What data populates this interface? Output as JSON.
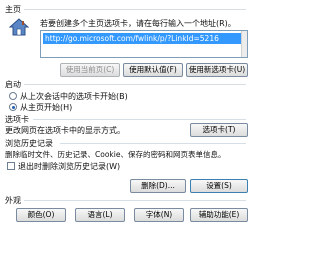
{
  "home": {
    "title": "主页",
    "instruction": "若要创建多个主页选项卡，请在每行输入一个地址(R)。",
    "url": "http://go.microsoft.com/fwlink/p/?LinkId=5216",
    "use_current_label": "使用当前页(C)",
    "use_default_label": "使用默认值(F)",
    "use_new_tab_label": "使用新选项卡(U)"
  },
  "startup": {
    "title": "启动",
    "option_last_session": "从上次会话中的选项卡开始(B)",
    "option_home": "从主页开始(H)",
    "selected": "option_home"
  },
  "tabs": {
    "title": "选项卡",
    "description": "更改网页在选项卡中的显示方式。",
    "button_label": "选项卡(T)"
  },
  "history": {
    "title": "浏览历史记录",
    "description": "删除临时文件、历史记录、Cookie、保存的密码和网页表单信息。",
    "delete_on_exit_label": "退出时删除浏览历史记录(W)",
    "delete_on_exit_checked": false,
    "delete_label": "删除(D)...",
    "settings_label": "设置(S)"
  },
  "appearance": {
    "title": "外观",
    "colors_label": "颜色(O)",
    "languages_label": "语言(L)",
    "fonts_label": "字体(N)",
    "accessibility_label": "辅助功能(E)"
  },
  "colors": {
    "selection": "#3399ff",
    "border": "#7a8ba0",
    "group_line": "#d5dfe5"
  }
}
